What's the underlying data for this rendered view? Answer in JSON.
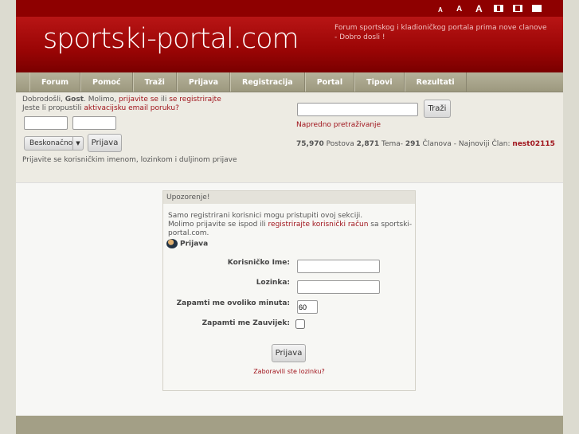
{
  "header": {
    "text_sizes": [
      "A",
      "A",
      "A"
    ],
    "logo": "sportski-portal.com",
    "tagline": "Forum sportskog i kladioničkog portala prima nove clanove - Dobro dosli !"
  },
  "nav": [
    "Forum",
    "Pomoć",
    "Traži",
    "Prijava",
    "Registracija",
    "Portal",
    "Tipovi",
    "Rezultati"
  ],
  "userbar": {
    "welcome": "Dobrodošli, ",
    "guest": "Gost",
    "please": ". Molimo, ",
    "login_link": "prijavite se",
    "or": " ili ",
    "register_link": "se registrirajte",
    "missed": "Jeste li propustili ",
    "activation_link": "aktivacijsku email poruku?",
    "duration": "Beskonačno",
    "login_btn": "Prijava",
    "hint": "Prijavite se korisničkim imenom, lozinkom i duljinom prijave"
  },
  "search": {
    "button": "Traži",
    "advanced": "Napredno pretraživanje"
  },
  "stats": {
    "posts": "75,970",
    "posts_l": " Postova ",
    "topics": "2,871",
    "topics_l": " Tema- ",
    "members": "291",
    "members_l": " Članova - Najnoviji Član: ",
    "newest": "nest02115"
  },
  "warning": {
    "title": "Upozorenje!",
    "line1": "Samo registrirani korisnici mogu pristupiti ovoj sekciji.",
    "line2a": "Molimo prijavite se ispod ili ",
    "line2_link": "registrirajte korisnički račun",
    "line2b": " sa sportski-portal.com.",
    "login_heading": "Prijava",
    "username_label": "Korisničko Ime:",
    "password_label": "Lozinka:",
    "minutes_label": "Zapamti me ovoliko minuta:",
    "minutes_value": "60",
    "forever_label": "Zapamti me Zauvijek:",
    "submit": "Prijava",
    "forgot": "Zaboravili ste lozinku?"
  }
}
